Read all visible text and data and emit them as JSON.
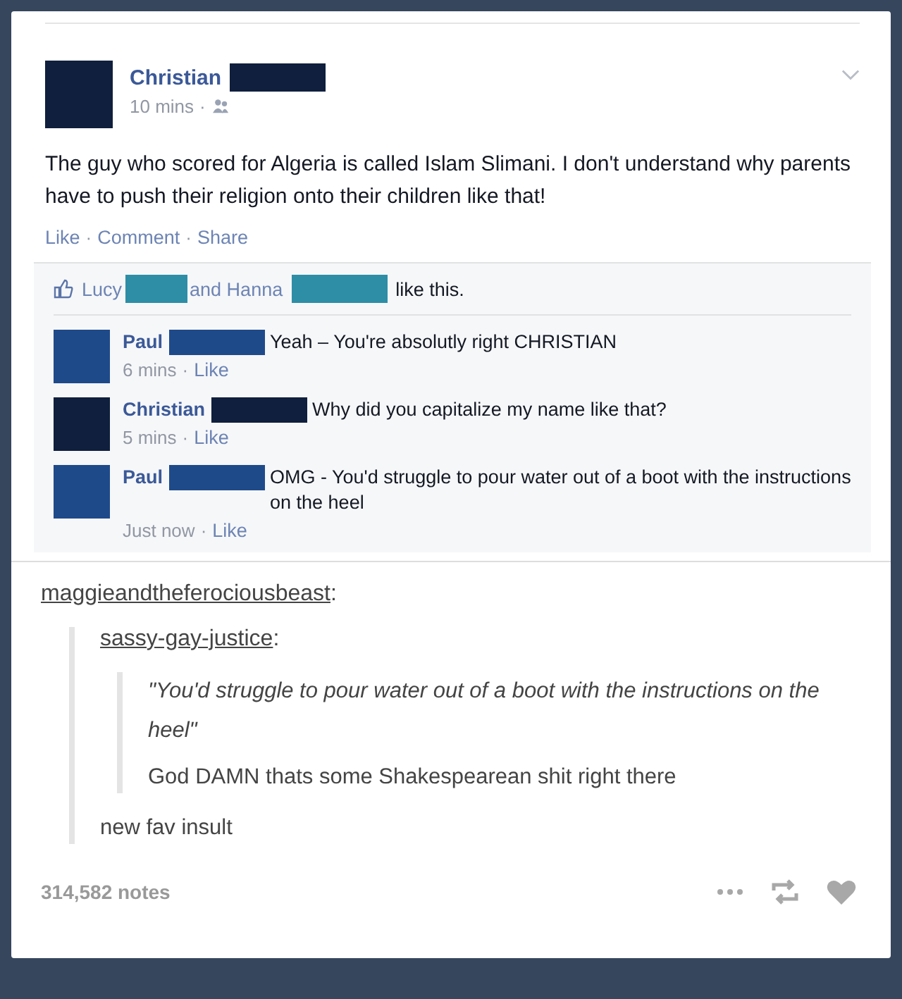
{
  "post": {
    "author": "Christian",
    "time": "10 mins",
    "separator": "·",
    "text": "The guy who scored for Algeria is called Islam Slimani. I don't understand why parents have to push their religion onto their children like that!",
    "actions": [
      "Like",
      "Comment",
      "Share"
    ],
    "likes": {
      "first": "Lucy",
      "middle": "and Hanna",
      "end": "like this."
    },
    "comments": [
      {
        "author": "Paul",
        "text": "Yeah – You're absolutly right CHRISTIAN",
        "time": "6 mins",
        "action": "Like"
      },
      {
        "author": "Christian",
        "text": "Why did you capitalize my name like that?",
        "time": "5 mins",
        "action": "Like"
      },
      {
        "author": "Paul",
        "text": "OMG - You'd struggle to pour water out of a boot with the instructions on the heel",
        "time": "Just now",
        "action": "Like"
      }
    ]
  },
  "reblog": {
    "user1": "maggieandtheferociousbeast",
    "user2": "sassy-gay-justice",
    "colon": ":",
    "quote": "\"You'd struggle to pour water out of a boot with the instructions on the heel\"",
    "reply2": "God DAMN thats some Shakespearean shit right there",
    "reply1": "new fav insult",
    "notes": "314,582 notes"
  }
}
